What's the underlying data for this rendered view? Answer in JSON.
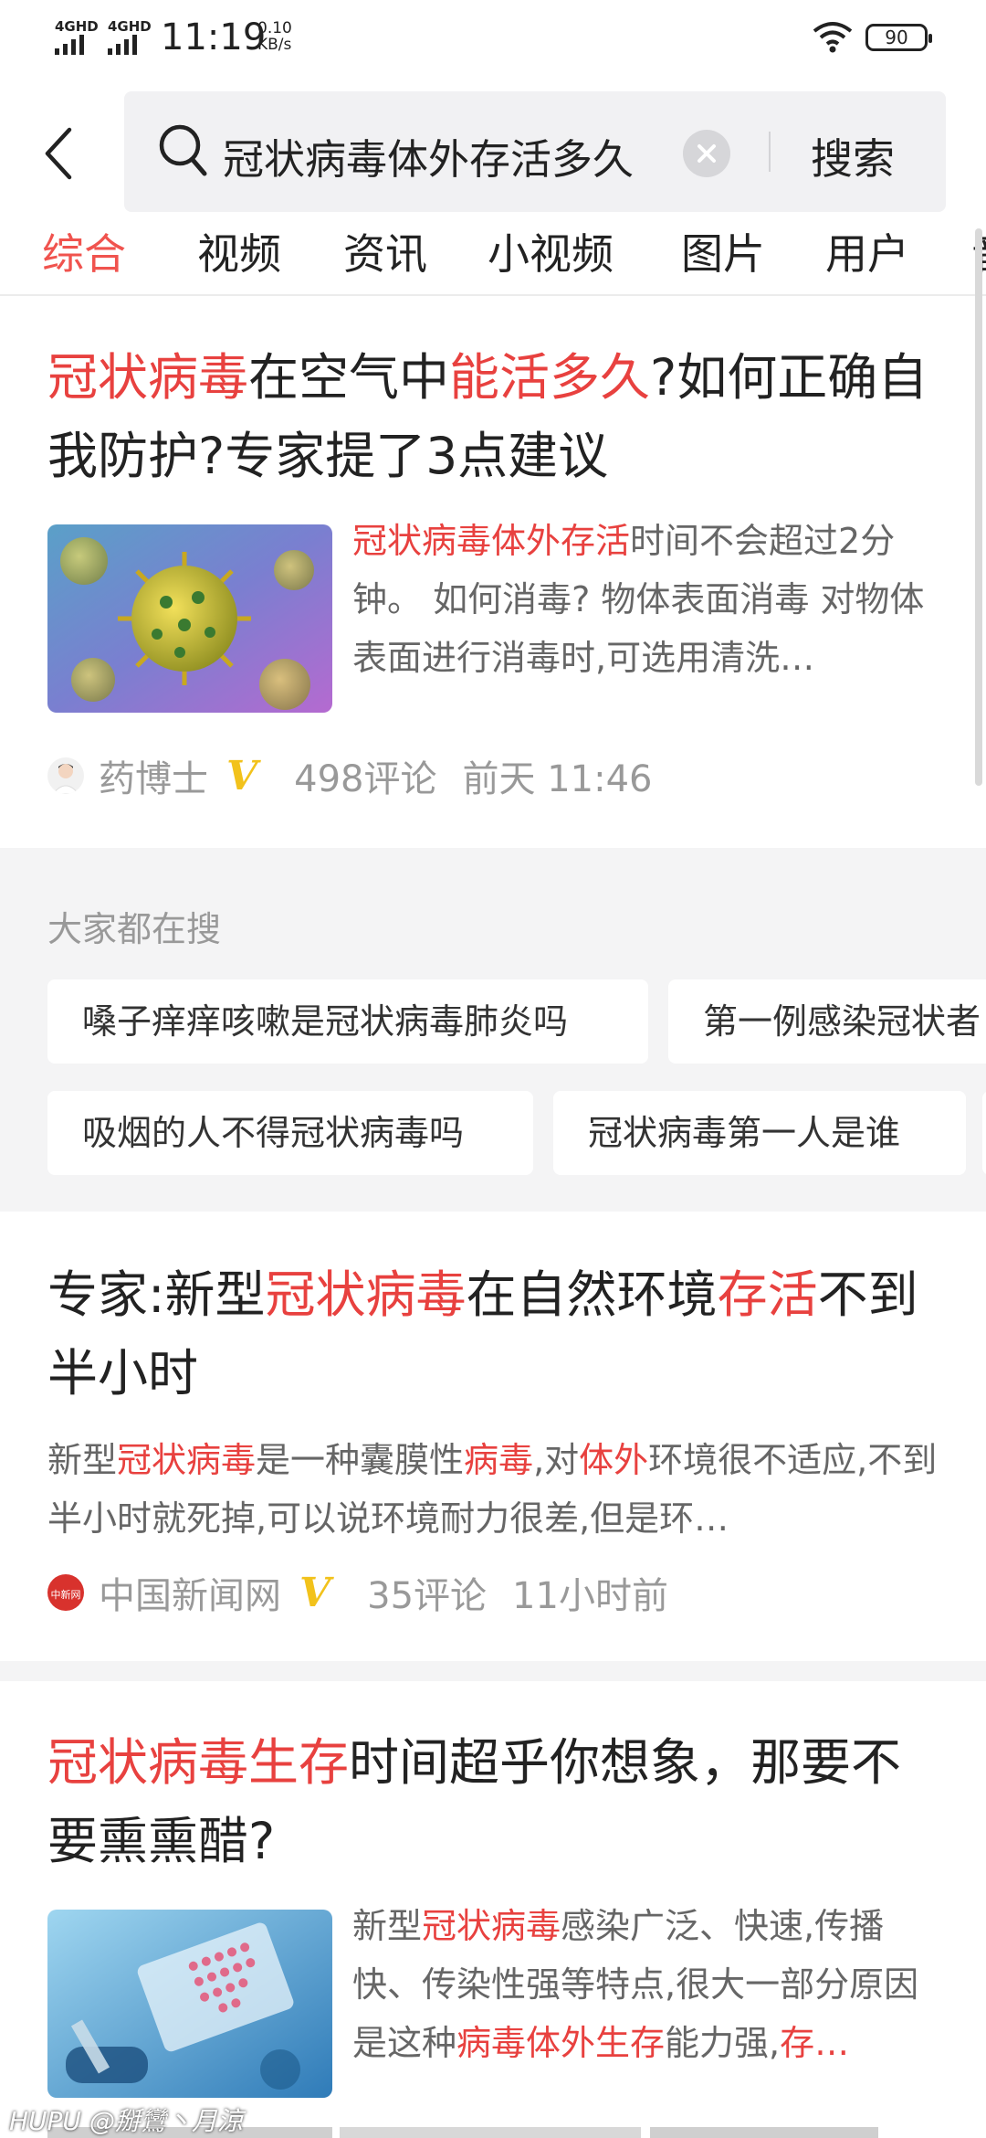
{
  "status_bar": {
    "signal1": "4GHD",
    "signal2": "4GHD",
    "time": "11:19",
    "speed_value": "0.10",
    "speed_unit": "KB/s",
    "battery": "90"
  },
  "search": {
    "query": "冠状病毒体外存活多久",
    "button": "搜索"
  },
  "tabs": [
    "综合",
    "视频",
    "资讯",
    "小视频",
    "图片",
    "用户",
    "音"
  ],
  "active_tab": 0,
  "articles": [
    {
      "title": [
        {
          "t": "冠状病毒",
          "hl": true
        },
        {
          "t": "在空气中",
          "hl": false
        },
        {
          "t": "能活多久",
          "hl": true
        },
        {
          "t": "?如何正确自我防护?专家提了3点建议",
          "hl": false
        }
      ],
      "snippet": [
        {
          "t": "冠状病毒体外存活",
          "hl": true
        },
        {
          "t": "时间不会超过2分钟。 如何消毒? 物体表面消毒 对物体表面进行消毒时,可选用清洗…",
          "hl": false
        }
      ],
      "source": "药博士",
      "comments": "498评论",
      "time": "前天 11:46",
      "thumb_icon": "virus-image"
    },
    {
      "title": [
        {
          "t": "专家:新型",
          "hl": false
        },
        {
          "t": "冠状病毒",
          "hl": true
        },
        {
          "t": "在自然环境",
          "hl": false
        },
        {
          "t": "存活",
          "hl": true
        },
        {
          "t": "不到半小时",
          "hl": false
        }
      ],
      "snippet": [
        {
          "t": "新型",
          "hl": false
        },
        {
          "t": "冠状病毒",
          "hl": true
        },
        {
          "t": "是一种囊膜性",
          "hl": false
        },
        {
          "t": "病毒",
          "hl": true
        },
        {
          "t": ",对",
          "hl": false
        },
        {
          "t": "体外",
          "hl": true
        },
        {
          "t": "环境很不适应,不到半小时就死掉,可以说环境耐力很差,但是环…",
          "hl": false
        }
      ],
      "source": "中国新闻网",
      "source_logo_text": "中新网",
      "comments": "35评论",
      "time": "11小时前"
    },
    {
      "title": [
        {
          "t": "冠状病毒生存",
          "hl": true
        },
        {
          "t": "时间超乎你想象，那要不要熏熏醋?",
          "hl": false
        }
      ],
      "snippet": [
        {
          "t": "新型",
          "hl": false
        },
        {
          "t": "冠状病毒",
          "hl": true
        },
        {
          "t": "感染广泛、快速,传播快、传染性强等特点,很大一部分原因是这种",
          "hl": false
        },
        {
          "t": "病毒体外生存",
          "hl": true
        },
        {
          "t": "能力强,",
          "hl": false
        },
        {
          "t": "存…",
          "hl": true
        }
      ],
      "thumb_icon": "lab-image"
    }
  ],
  "hot_search": {
    "heading": "大家都在搜",
    "row1": [
      "嗓子痒痒咳嗽是冠状病毒肺炎吗",
      "第一例感染冠状者"
    ],
    "row2": [
      "吸烟的人不得冠状病毒吗",
      "冠状病毒第一人是谁"
    ]
  },
  "verified_badge": "V",
  "watermark": "HUPU @掰鸞丶月涼",
  "colors": {
    "highlight": "#e8413f",
    "active_tab": "#f0534e",
    "badge": "#f2c21b",
    "muted": "#999999"
  }
}
